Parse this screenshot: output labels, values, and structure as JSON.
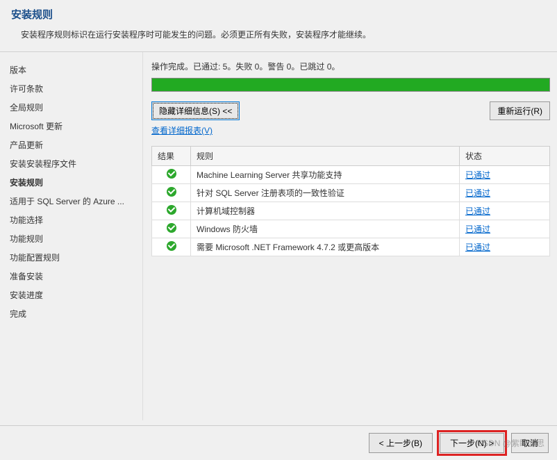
{
  "header": {
    "title": "安装规则",
    "subtitle": "安装程序规则标识在运行安装程序时可能发生的问题。必须更正所有失败，安装程序才能继续。"
  },
  "sidebar": {
    "items": [
      {
        "label": "版本",
        "active": false
      },
      {
        "label": "许可条款",
        "active": false
      },
      {
        "label": "全局规则",
        "active": false
      },
      {
        "label": "Microsoft 更新",
        "active": false
      },
      {
        "label": "产品更新",
        "active": false
      },
      {
        "label": "安装安装程序文件",
        "active": false
      },
      {
        "label": "安装规则",
        "active": true
      },
      {
        "label": "适用于 SQL Server 的 Azure ...",
        "active": false
      },
      {
        "label": "功能选择",
        "active": false
      },
      {
        "label": "功能规则",
        "active": false
      },
      {
        "label": "功能配置规则",
        "active": false
      },
      {
        "label": "准备安装",
        "active": false
      },
      {
        "label": "安装进度",
        "active": false
      },
      {
        "label": "完成",
        "active": false
      }
    ]
  },
  "main": {
    "status_text": "操作完成。已通过: 5。失败 0。警告 0。已跳过 0。",
    "hide_details_btn": "隐藏详细信息(S) <<",
    "rerun_btn": "重新运行(R)",
    "view_report_link": "查看详细报表(V)",
    "table": {
      "headers": {
        "result": "结果",
        "rule": "规则",
        "status": "状态"
      },
      "rows": [
        {
          "rule": "Machine Learning Server 共享功能支持",
          "status": "已通过"
        },
        {
          "rule": "针对 SQL Server 注册表项的一致性验证",
          "status": "已通过"
        },
        {
          "rule": "计算机域控制器",
          "status": "已通过"
        },
        {
          "rule": "Windows 防火墙",
          "status": "已通过"
        },
        {
          "rule": "需要 Microsoft .NET Framework 4.7.2 或更高版本",
          "status": "已通过"
        }
      ]
    }
  },
  "footer": {
    "back": "< 上一步(B)",
    "next": "下一步(N) >",
    "cancel": "取消"
  },
  "watermark": "CSDN @紫眸龙思"
}
